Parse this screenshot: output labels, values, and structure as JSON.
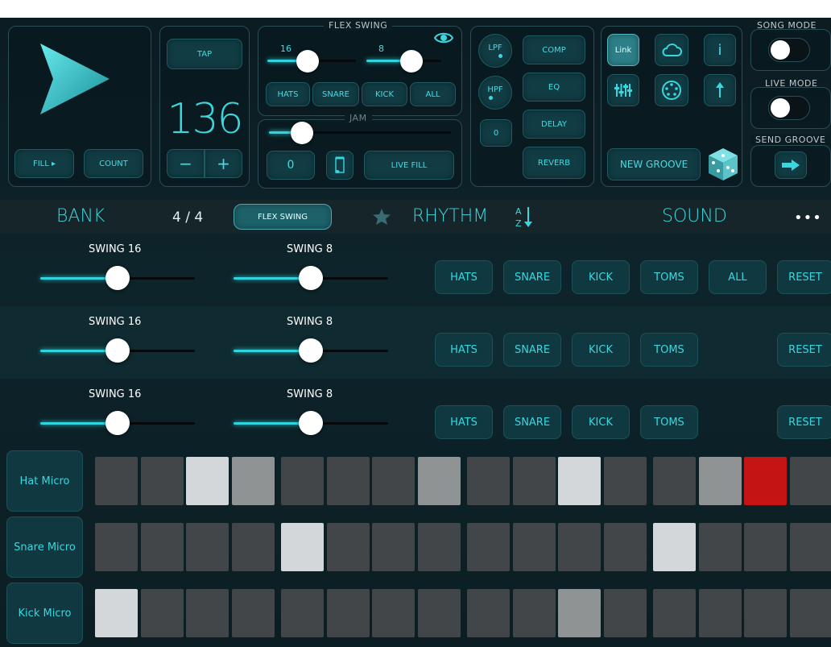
{
  "transport": {
    "fill_label": "FILL ▸",
    "count_label": "COUNT"
  },
  "tempo": {
    "tap_label": "TAP",
    "bpm": "136",
    "minus": "−",
    "plus": "+"
  },
  "flex_swing": {
    "title": "FLEX SWING",
    "slider_16_label": "16",
    "slider_16_value": 0.45,
    "slider_8_label": "8",
    "slider_8_value": 0.6,
    "buttons": [
      "HATS",
      "SNARE",
      "KICK",
      "ALL"
    ]
  },
  "jam": {
    "title": "JAM",
    "slider_value": 0.18,
    "counter": "0",
    "live_fill_label": "LIVE FILL"
  },
  "fx": {
    "lpf": "LPF",
    "hpf": "HPF",
    "zero": "0",
    "comp": "COMP",
    "eq": "EQ",
    "delay": "DELAY",
    "reverb": "REVERB"
  },
  "link": {
    "link_label": "Link",
    "info_label": "i",
    "new_groove_label": "NEW GROOVE"
  },
  "modes": {
    "song_mode": "SONG MODE",
    "live_mode": "LIVE MODE",
    "send_groove": "SEND GROOVE"
  },
  "tabs": {
    "bank": "BANK",
    "time_sig": "4 / 4",
    "flex_swing": "FLEX SWING",
    "rhythm": "RHYTHM",
    "sort": "A↓Z",
    "sound": "SOUND",
    "more": "•••"
  },
  "swing_rows": [
    {
      "swing16_label": "SWING 16",
      "swing16_value": 0.5,
      "swing8_label": "SWING 8",
      "swing8_value": 0.5,
      "buttons": [
        "HATS",
        "SNARE",
        "KICK",
        "TOMS",
        "ALL",
        "RESET"
      ]
    },
    {
      "swing16_label": "SWING 16",
      "swing16_value": 0.5,
      "swing8_label": "SWING 8",
      "swing8_value": 0.5,
      "buttons": [
        "HATS",
        "SNARE",
        "KICK",
        "TOMS",
        "",
        "RESET"
      ]
    },
    {
      "swing16_label": "SWING 16",
      "swing16_value": 0.5,
      "swing8_label": "SWING 8",
      "swing8_value": 0.5,
      "buttons": [
        "HATS",
        "SNARE",
        "KICK",
        "TOMS",
        "",
        "RESET"
      ]
    }
  ],
  "micro_rows": [
    {
      "label": "Hat Micro",
      "levels": [
        0,
        0,
        2,
        1,
        0,
        0,
        0,
        1,
        0,
        0,
        2,
        0,
        0,
        1,
        3,
        0
      ]
    },
    {
      "label": "Snare Micro",
      "levels": [
        0,
        0,
        0,
        0,
        2,
        0,
        0,
        0,
        0,
        0,
        0,
        0,
        2,
        0,
        0,
        0
      ]
    },
    {
      "label": "Kick Micro",
      "levels": [
        2,
        0,
        0,
        0,
        0,
        0,
        0,
        0,
        0,
        0,
        1,
        0,
        0,
        0,
        0,
        0
      ]
    }
  ],
  "colors": {
    "accent": "#3ad7df",
    "background": "#0b1c22",
    "cell_off": "#434649",
    "cell_mid": "#909394",
    "cell_high": "#d4d7d9",
    "cell_red": "#c41414"
  }
}
